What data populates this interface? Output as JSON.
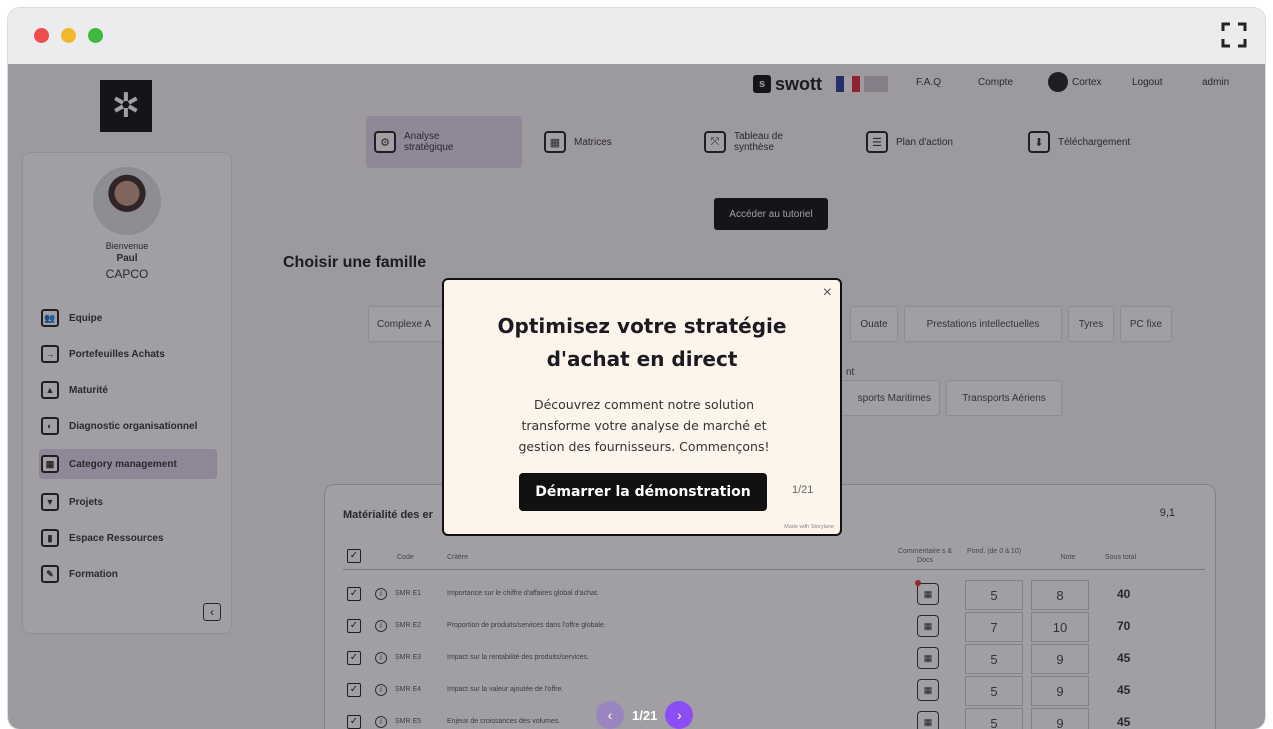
{
  "header": {
    "brand": "swott",
    "links": [
      "F.A.Q",
      "Compte",
      "Cortex",
      "Logout",
      "admin"
    ],
    "tutorial_button": "Accéder au tutoriel"
  },
  "nav": [
    {
      "label_line1": "Analyse",
      "label_line2": "stratégique",
      "active": true
    },
    {
      "label_line1": "Matrices",
      "label_line2": ""
    },
    {
      "label_line1": "Tableau de",
      "label_line2": "synthèse"
    },
    {
      "label_line1": "Plan d'action",
      "label_line2": ""
    },
    {
      "label_line1": "Téléchargement",
      "label_line2": ""
    }
  ],
  "sidebar": {
    "welcome": "Bienvenue",
    "user": "Paul",
    "company": "CAPCO",
    "items": [
      {
        "label": "Equipe"
      },
      {
        "label": "Portefeuilles Achats"
      },
      {
        "label": "Maturité"
      },
      {
        "label": "Diagnostic organisationnel"
      },
      {
        "label": "Category management",
        "active": true
      },
      {
        "label": "Projets"
      },
      {
        "label": "Espace Ressources"
      },
      {
        "label": "Formation"
      }
    ]
  },
  "family": {
    "title": "Choisir une famille",
    "chips_row1": [
      "Complexe A",
      "Ouate",
      "Prestations intellectuelles",
      "Tyres",
      "PC fixe"
    ],
    "partial_text": "nt",
    "chips_row2": [
      "sports Maritimes",
      "Transports Aériens"
    ]
  },
  "table": {
    "title": "Matérialité des er",
    "score": "9,1",
    "headers": {
      "code": "Code",
      "critere": "Critère",
      "comments": "Commentaire s & Docs",
      "pond": "Pond. (de 0 à 10)",
      "note": "Note",
      "sous_total": "Sous total"
    },
    "rows": [
      {
        "code": "SMR E1",
        "critere": "Importance sur le chiffre d'affaires global d'achat.",
        "pond": "5",
        "note": "8",
        "total": "40"
      },
      {
        "code": "SMR E2",
        "critere": "Proportion de produits/services dans l'offre globale.",
        "pond": "7",
        "note": "10",
        "total": "70"
      },
      {
        "code": "SMR E3",
        "critere": "Impact sur la rentabilité des produits/services.",
        "pond": "5",
        "note": "9",
        "total": "45"
      },
      {
        "code": "SMR E4",
        "critere": "Impact sur la valeur ajoutée de l'offre.",
        "pond": "5",
        "note": "9",
        "total": "45"
      },
      {
        "code": "SMR E5",
        "critere": "Enjeux de croissances des volumes.",
        "pond": "5",
        "note": "9",
        "total": "45"
      }
    ]
  },
  "modal": {
    "title_line1": "Optimisez votre stratégie",
    "title_line2": "d'achat en direct",
    "body_line1": "Découvrez comment notre solution",
    "body_line2": "transforme votre analyse de marché et",
    "body_line3": "gestion des fournisseurs. Commençons!",
    "cta": "Démarrer la démonstration",
    "step": "1/21",
    "made_with": "Made with Storylane",
    "close": "×"
  },
  "pager": {
    "text": "1/21",
    "prev": "‹",
    "next": "›"
  },
  "colors": {
    "accent": "#8b4ef5",
    "active_bg": "#e2d6ec",
    "modal_bg": "#fdf4ec"
  }
}
